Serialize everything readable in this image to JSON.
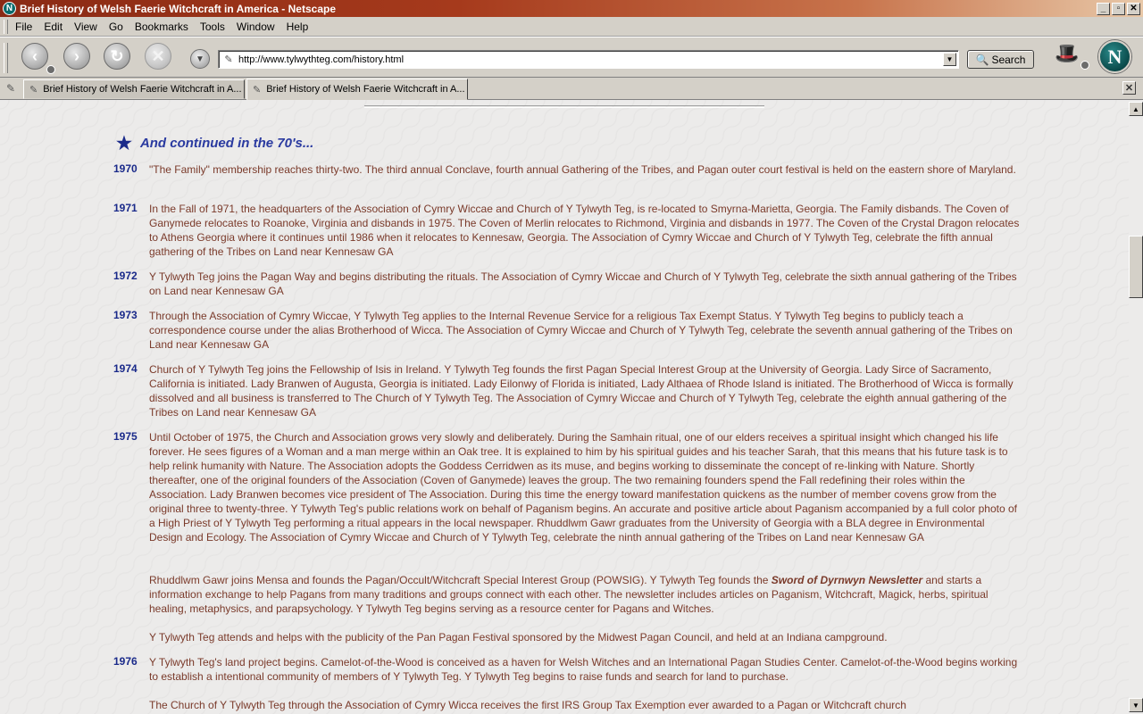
{
  "window": {
    "app_icon": "N",
    "title": "Brief History of Welsh Faerie Witchcraft in America - Netscape",
    "controls": {
      "minimize": "_",
      "maximize": "▫",
      "close": "✕"
    }
  },
  "menu": [
    {
      "label": "File"
    },
    {
      "label": "Edit"
    },
    {
      "label": "View"
    },
    {
      "label": "Go"
    },
    {
      "label": "Bookmarks"
    },
    {
      "label": "Tools"
    },
    {
      "label": "Window"
    },
    {
      "label": "Help"
    }
  ],
  "toolbar": {
    "back_glyph": "‹",
    "forward_glyph": "›",
    "reload_glyph": "↻",
    "stop_glyph": "✕",
    "url": "http://www.tylwythteg.com/history.html",
    "search_label": "Search",
    "throbber_letter": "N"
  },
  "tabs": [
    {
      "label": "Brief History of Welsh Faerie Witchcraft in A..."
    },
    {
      "label": "Brief History of Welsh Faerie Witchcraft in A..."
    }
  ],
  "content": {
    "heading": "And continued in the 70's...",
    "entries": [
      {
        "year": "1970",
        "paragraphs": [
          "\"The Family\" membership reaches thirty-two. The third annual Conclave, fourth annual Gathering of the Tribes, and Pagan outer court festival is held on the eastern shore of Maryland."
        ]
      },
      {
        "year": "1971",
        "paragraphs": [
          "In the Fall of 1971, the headquarters of the Association of Cymry Wiccae and Church of Y Tylwyth Teg, is re-located to Smyrna-Marietta, Georgia. The Family disbands. The Coven of Ganymede relocates to Roanoke, Virginia and disbands in 1975. The Coven of Merlin relocates to Richmond, Virginia and disbands in 1977. The Coven of the Crystal Dragon relocates to Athens Georgia where it continues until 1986 when it relocates to Kennesaw, Georgia.  The Association of Cymry Wiccae and Church of Y Tylwyth Teg, celebrate the fifth annual gathering of the Tribes on Land near Kennesaw GA"
        ]
      },
      {
        "year": "1972",
        "paragraphs": [
          "Y Tylwyth Teg joins the Pagan Way and begins distributing the rituals.  The Association of Cymry Wiccae and Church of Y Tylwyth Teg, celebrate the sixth annual gathering of the Tribes on Land near Kennesaw GA"
        ]
      },
      {
        "year": "1973",
        "paragraphs": [
          "Through the Association of Cymry Wiccae, Y Tylwyth Teg applies to the Internal Revenue Service for a religious Tax Exempt Status. Y Tylwyth Teg begins to publicly teach a correspondence course under the alias Brotherhood of Wicca.  The Association of Cymry Wiccae and Church of Y Tylwyth Teg, celebrate the seventh annual gathering of the Tribes on Land near Kennesaw GA"
        ]
      },
      {
        "year": "1974",
        "paragraphs": [
          "Church of Y Tylwyth Teg joins the Fellowship of Isis in Ireland. Y Tylwyth Teg founds the first Pagan Special Interest Group at the University of Georgia. Lady Sirce of Sacramento, California is initiated. Lady Branwen of Augusta, Georgia is initiated. Lady Eilonwy of Florida is initiated, Lady Althaea of Rhode Island is initiated. The Brotherhood of Wicca is formally dissolved and all business is transferred to The Church of Y Tylwyth Teg.  The Association of Cymry Wiccae and Church of Y Tylwyth Teg, celebrate the eighth annual gathering of the Tribes on Land near Kennesaw GA"
        ]
      },
      {
        "year": "1975",
        "paragraphs": [
          "Until October of 1975, the Church and Association grows very slowly and deliberately. During the Samhain ritual, one of our elders receives a spiritual insight which changed his life forever. He sees figures of a Woman and a man merge within an Oak tree. It is explained to him by his spiritual guides and his teacher Sarah, that this means that his future task is to help relink humanity with Nature. The Association adopts the Goddess Cerridwen as its muse, and begins working to disseminate the concept of re-linking with Nature. Shortly thereafter, one of the original founders of the Association (Coven of Ganymede) leaves the group. The two remaining founders spend the Fall redefining their roles within the Association. Lady Branwen becomes vice president of The Association.  During this time the energy toward manifestation quickens as the number of member covens grow from the original three to twenty-three.  Y Tylwyth Teg's public relations work on behalf of Paganism begins. An accurate and positive article about Paganism accompanied by a full color photo of a High Priest of Y Tylwyth Teg performing a ritual appears in the local newspaper. Rhuddlwm Gawr graduates from the University of Georgia with a BLA degree in Environmental Design and Ecology.  The Association of Cymry Wiccae and Church of Y Tylwyth Teg, celebrate the ninth annual gathering of the Tribes on Land near Kennesaw GA",
          "Rhuddlwm Gawr joins Mensa and founds the Pagan/Occult/Witchcraft Special Interest Group (POWSIG). Y Tylwyth Teg founds the ",
          "Y Tylwyth Teg attends and helps with the publicity of the Pan Pagan Festival sponsored by the Midwest Pagan Council, and held at an Indiana campground."
        ],
        "newsletter_title": "Sword of Dyrnwyn Newsletter",
        "newsletter_rest": " and starts a information exchange to help Pagans from many traditions and groups connect with each other. The newsletter includes articles on Paganism, Witchcraft, Magick, herbs, spiritual healing, metaphysics, and parapsychology. Y Tylwyth Teg begins serving as a resource center for Pagans and Witches."
      },
      {
        "year": "1976",
        "paragraphs": [
          "Y Tylwyth Teg's land project begins. Camelot-of-the-Wood is conceived as a haven for Welsh Witches and an International Pagan Studies Center. Camelot-of-the-Wood begins working to establish a intentional community of members of Y Tylwyth Teg. Y Tylwyth Teg begins to raise funds and search for land to purchase.",
          "The Church of Y Tylwyth Teg through the Association of Cymry Wicca receives the first IRS Group Tax Exemption ever awarded to a Pagan or Witchcraft church"
        ]
      }
    ]
  },
  "icons": {
    "heading_star": "★",
    "page_icon": "✎",
    "search_icon": "🔍",
    "hat_icon": "🎩"
  },
  "colors": {
    "year": "#1a2a8a",
    "body_text": "#7a3a2a",
    "heading": "#2a3aa0",
    "titlebar": "#8a2a14"
  }
}
